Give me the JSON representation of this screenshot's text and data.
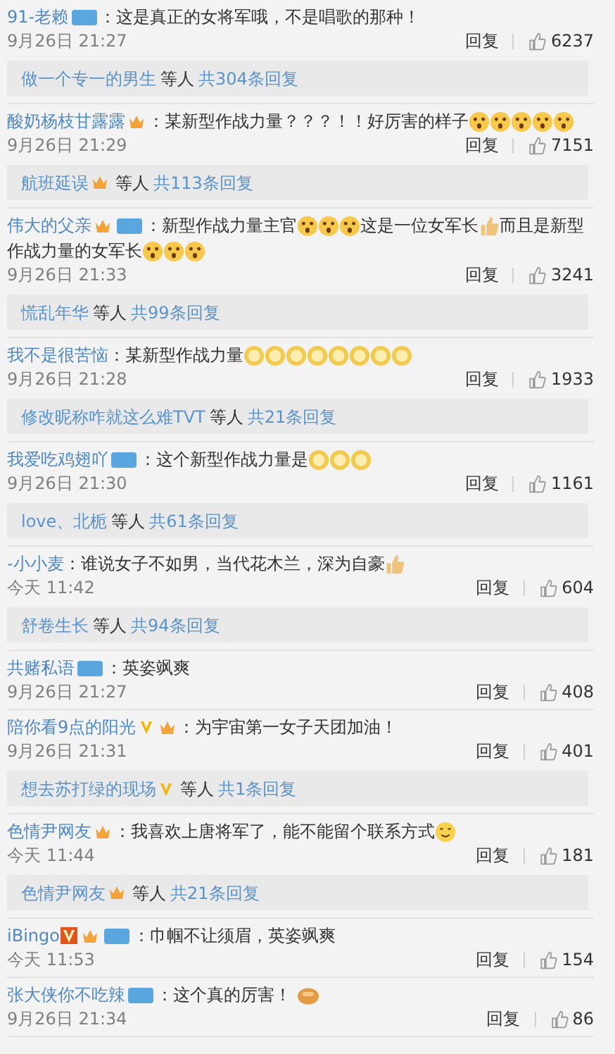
{
  "comments": [
    {
      "user": "91-老赖",
      "badges": [
        {
          "kind": "fan"
        }
      ],
      "parts": [
        {
          "kind": "text",
          "text": "：这是真正的女将军哦，不是唱歌的那种！"
        }
      ],
      "time": "9月26日 21:27",
      "reply": "回复",
      "likes": "6237",
      "thread": {
        "name": "做一个专一的男生",
        "mid": "等人",
        "count": "共304条回复"
      }
    },
    {
      "user": "酸奶杨枝甘露露",
      "badges": [
        {
          "kind": "crown"
        }
      ],
      "parts": [
        {
          "kind": "text",
          "text": "：某新型作战力量？？？！！好厉害的样子"
        },
        {
          "kind": "shock"
        },
        {
          "kind": "shock"
        },
        {
          "kind": "shock"
        },
        {
          "kind": "shock"
        },
        {
          "kind": "shock"
        }
      ],
      "time": "9月26日 21:29",
      "reply": "回复",
      "likes": "7151",
      "thread": {
        "name": "航班延误",
        "badges": [
          {
            "kind": "crown"
          }
        ],
        "mid": "等人",
        "count": "共113条回复"
      }
    },
    {
      "user": "伟大的父亲",
      "badges": [
        {
          "kind": "crown"
        },
        {
          "kind": "fan"
        }
      ],
      "parts": [
        {
          "kind": "text",
          "text": "：新型作战力量主官"
        },
        {
          "kind": "shock"
        },
        {
          "kind": "shock"
        },
        {
          "kind": "shock"
        },
        {
          "kind": "text",
          "text": "这是一位女军长"
        },
        {
          "kind": "thumb"
        },
        {
          "kind": "text",
          "text": "而且是新型"
        },
        {
          "kind": "text",
          "text": "作战力量的女军长"
        },
        {
          "kind": "shock"
        },
        {
          "kind": "shock"
        },
        {
          "kind": "shock"
        }
      ],
      "time": "9月26日 21:33",
      "reply": "回复",
      "likes": "3241",
      "thread": {
        "name": "慌乱年华",
        "mid": "等人",
        "count": "共99条回复"
      }
    },
    {
      "user": "我不是很苦恼",
      "parts": [
        {
          "kind": "text",
          "text": "：某新型作战力量"
        },
        {
          "kind": "ring"
        },
        {
          "kind": "ring"
        },
        {
          "kind": "ring"
        },
        {
          "kind": "ring"
        },
        {
          "kind": "ring"
        },
        {
          "kind": "ring"
        },
        {
          "kind": "ring"
        },
        {
          "kind": "ring"
        }
      ],
      "time": "9月26日 21:28",
      "reply": "回复",
      "likes": "1933",
      "thread": {
        "name": "修改昵称咋就这么难TVT",
        "mid": "等人",
        "count": "共21条回复"
      }
    },
    {
      "user": "我爱吃鸡翅吖",
      "badges": [
        {
          "kind": "fan"
        }
      ],
      "parts": [
        {
          "kind": "text",
          "text": "：这个新型作战力量是"
        },
        {
          "kind": "ring"
        },
        {
          "kind": "ring"
        },
        {
          "kind": "ring"
        }
      ],
      "time": "9月26日 21:30",
      "reply": "回复",
      "likes": "1161",
      "thread": {
        "name": "love、北栀",
        "mid": "等人",
        "count": "共61条回复"
      }
    },
    {
      "user": "-小小麦",
      "parts": [
        {
          "kind": "text",
          "text": "：谁说女子不如男，当代花木兰，深为自豪"
        },
        {
          "kind": "thumb"
        }
      ],
      "time": "今天 11:42",
      "reply": "回复",
      "likes": "604",
      "thread": {
        "name": "舒卷生长",
        "mid": "等人",
        "count": "共94条回复"
      }
    },
    {
      "user": "共赌私语",
      "badges": [
        {
          "kind": "fan"
        }
      ],
      "parts": [
        {
          "kind": "text",
          "text": "：英姿飒爽"
        }
      ],
      "time": "9月26日 21:27",
      "reply": "回复",
      "likes": "408"
    },
    {
      "user": "陪你看9点的阳光",
      "badges": [
        {
          "kind": "vgold"
        },
        {
          "kind": "crown"
        }
      ],
      "parts": [
        {
          "kind": "text",
          "text": "：为宇宙第一女子天团加油！"
        }
      ],
      "time": "9月26日 21:31",
      "reply": "回复",
      "likes": "401",
      "thread": {
        "name": "想去苏打绿的现场",
        "badges": [
          {
            "kind": "vgold"
          }
        ],
        "mid": "等人",
        "count": "共1条回复"
      }
    },
    {
      "user": "色情尹网友",
      "badges": [
        {
          "kind": "crown"
        }
      ],
      "parts": [
        {
          "kind": "text",
          "text": "：我喜欢上唐将军了，能不能留个联系方式"
        },
        {
          "kind": "blush"
        }
      ],
      "time": "今天 11:44",
      "reply": "回复",
      "likes": "181",
      "thread": {
        "name": "色情尹网友",
        "badges": [
          {
            "kind": "crown"
          }
        ],
        "mid": "等人",
        "count": "共21条回复"
      }
    },
    {
      "user": "iBingo",
      "badges": [
        {
          "kind": "vred"
        },
        {
          "kind": "crown"
        },
        {
          "kind": "fan"
        }
      ],
      "parts": [
        {
          "kind": "text",
          "text": "：巾帼不让须眉，英姿飒爽"
        }
      ],
      "time": "今天 11:53",
      "reply": "回复",
      "likes": "154"
    },
    {
      "user": "张大侠你不吃辣",
      "badges": [
        {
          "kind": "fan"
        }
      ],
      "parts": [
        {
          "kind": "text",
          "text": "：这个真的厉害！"
        },
        {
          "kind": "fist"
        }
      ],
      "time": "9月26日 21:34",
      "reply": "回复",
      "likes": "86"
    }
  ]
}
